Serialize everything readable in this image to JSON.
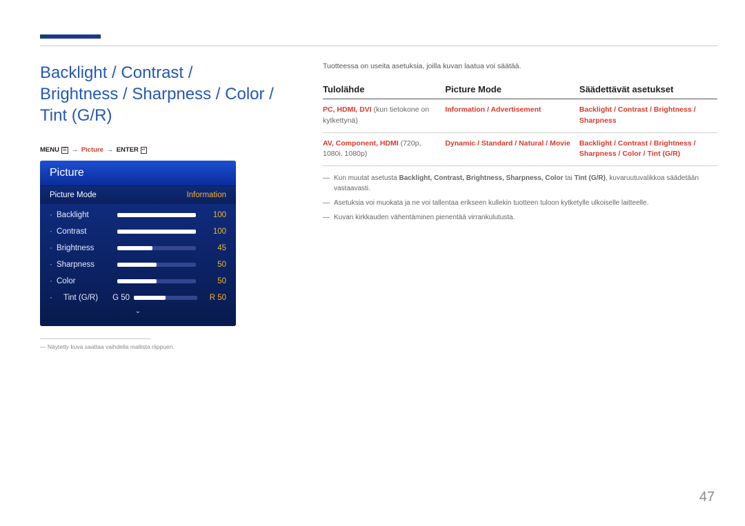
{
  "title": "Backlight / Contrast / Brightness / Sharpness / Color / Tint (G/R)",
  "menupath": {
    "menu": "MENU",
    "picture": "Picture",
    "enter": "ENTER"
  },
  "osd": {
    "header": "Picture",
    "mode_label": "Picture Mode",
    "mode_value": "Information",
    "sliders": [
      {
        "name": "Backlight",
        "value": "100",
        "pct": 100
      },
      {
        "name": "Contrast",
        "value": "100",
        "pct": 100
      },
      {
        "name": "Brightness",
        "value": "45",
        "pct": 45
      },
      {
        "name": "Sharpness",
        "value": "50",
        "pct": 50
      },
      {
        "name": "Color",
        "value": "50",
        "pct": 50
      }
    ],
    "tint": {
      "name": "Tint (G/R)",
      "g": "G 50",
      "r": "R 50"
    }
  },
  "footnote": "Näytetty kuva saattaa vaihdella mallista riippuen.",
  "intro": "Tuotteessa on useita asetuksia, joilla kuvan laatua voi säätää.",
  "table": {
    "headers": {
      "source": "Tulolähde",
      "mode": "Picture Mode",
      "adjust": "Säädettävät asetukset"
    },
    "rows": [
      {
        "source_red": "PC, HDMI, DVI",
        "source_rest": " (kun tietokone on kytkettynä)",
        "mode": "Information / Advertisement",
        "adjust": "Backlight / Contrast / Brightness / Sharpness"
      },
      {
        "source_red": "AV, Component, HDMI",
        "source_rest": " (720p, 1080i, 1080p)",
        "mode": "Dynamic / Standard / Natural / Movie",
        "adjust": "Backlight / Contrast / Brightness / Sharpness / Color / Tint (G/R)"
      }
    ]
  },
  "notes": {
    "n1_a": "Kun muutat asetusta ",
    "n1_list": "Backlight, Contrast, Brightness, Sharpness, Color",
    "n1_b": " tai ",
    "n1_tint": "Tint (G/R)",
    "n1_c": ", kuvaruutuvalikkoa säädetään vastaavasti.",
    "n2": "Asetuksia voi muokata ja ne voi tallentaa erikseen kullekin tuotteen tuloon kytketylle ulkoiselle laitteelle.",
    "n3": "Kuvan kirkkauden vähentäminen pienentää virrankulutusta."
  },
  "pagenum": "47"
}
